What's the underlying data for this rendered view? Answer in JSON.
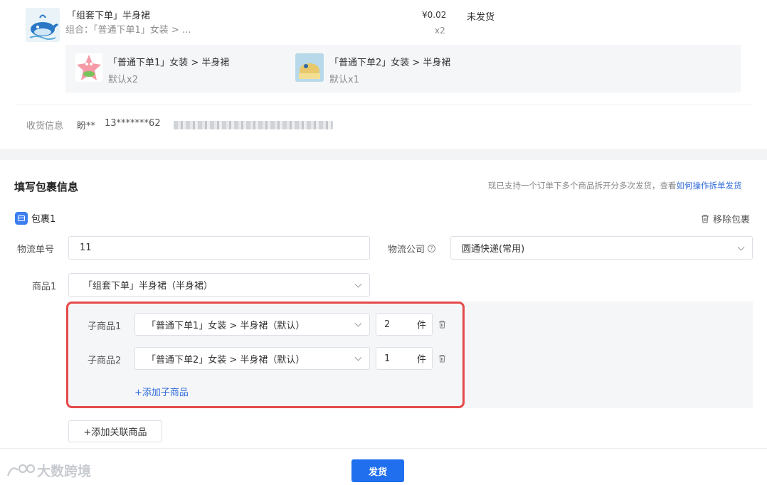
{
  "order": {
    "product_title": "「组套下单」半身裙",
    "combo_text": "组合：「普通下单1」女装 > ...",
    "price": "¥0.02",
    "quantity": "x2",
    "status": "未发货",
    "sub_items": [
      {
        "name": "「普通下单1」女装 > 半身裙",
        "spec": "默认x2"
      },
      {
        "name": "「普通下单2」女装 > 半身裙",
        "spec": "默认x1"
      }
    ],
    "shipping_label": "收货信息",
    "recipient": "盼**",
    "phone": "13*******62"
  },
  "form": {
    "title": "填写包裹信息",
    "hint": "现已支持一个订单下多个商品拆开分多次发货，查看",
    "hint_link": "如何操作拆单发货",
    "package_label": "包裹1",
    "remove_label": "移除包裹",
    "tracking_label": "物流单号",
    "tracking_value": "11",
    "carrier_label": "物流公司",
    "carrier_value": "圆通快递(常用)",
    "product_label": "商品1",
    "product_value": "「组套下单」半身裙（半身裙）",
    "sub_products": [
      {
        "label": "子商品1",
        "value": "「普通下单1」女装 > 半身裙（默认）",
        "qty": "2",
        "unit": "件"
      },
      {
        "label": "子商品2",
        "value": "「普通下单2」女装 > 半身裙（默认）",
        "qty": "1",
        "unit": "件"
      }
    ],
    "add_sub_label": "+添加子商品",
    "add_related_label": "+添加关联商品"
  },
  "footer": {
    "ship_button": "发货",
    "watermark": "大数跨境"
  },
  "colors": {
    "primary": "#1f6fef",
    "link": "#2f6bd8",
    "highlight": "#e5494a"
  }
}
